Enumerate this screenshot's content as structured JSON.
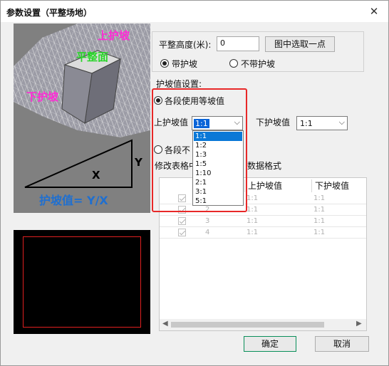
{
  "window": {
    "title": "参数设置（平整场地）",
    "close_glyph": "✕"
  },
  "illustration": {
    "label_top_slope": "上护坡",
    "label_flat": "平整面",
    "label_bottom_slope": "下护坡",
    "label_x": "X",
    "label_y": "Y",
    "formula": "护坡值= Y/X",
    "colors": {
      "top_slope": "#ff2bd6",
      "flat": "#29d629",
      "bottom_slope": "#ff2bd6",
      "formula": "#1f6fd0"
    }
  },
  "form": {
    "level_height_label": "平整高度(米):",
    "level_height_value": "0",
    "pick_point_button": "图中选取一点",
    "with_slope_label": "带护坡",
    "without_slope_label": "不带护坡",
    "slope_settings_label": "护坡值设置:",
    "equal_slope_label": "各段使用等坡值",
    "top_slope_label": "上护坡值",
    "top_slope_value": "1:1",
    "bottom_slope_label": "下护坡值",
    "bottom_slope_value": "1:1",
    "unequal_slope_label": "各段不",
    "edit_table_label_start": "修改表格中",
    "edit_table_label_end": "数据格式",
    "dropdown_options": [
      "1:1",
      "1:2",
      "1:3",
      "1:5",
      "1:10",
      "2:1",
      "3:1",
      "5:1"
    ]
  },
  "table": {
    "col_top": "上护坡值",
    "col_bottom": "下护坡值",
    "rows": [
      {
        "index": "1",
        "top": "1:1",
        "bottom": "1:1"
      },
      {
        "index": "2",
        "top": "1:1",
        "bottom": "1:1"
      },
      {
        "index": "3",
        "top": "1:1",
        "bottom": "1:1"
      },
      {
        "index": "4",
        "top": "1:1",
        "bottom": "1:1"
      }
    ]
  },
  "buttons": {
    "ok": "确定",
    "cancel": "取消"
  }
}
